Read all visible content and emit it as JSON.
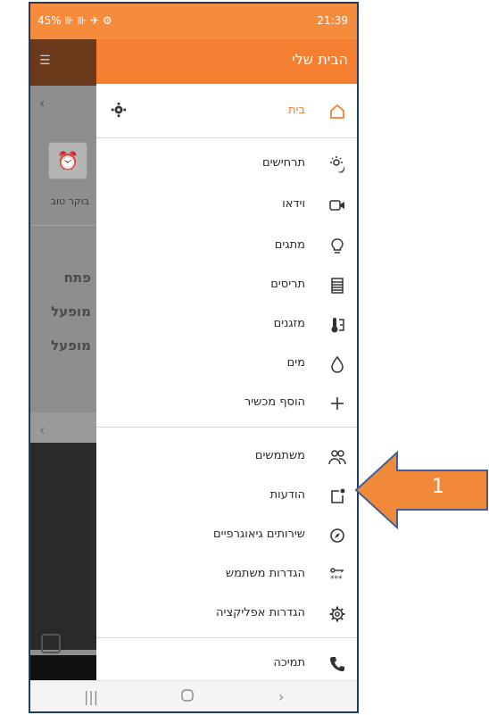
{
  "status_bar": {
    "left_text": "45% ⊪ ⊪ ✈ ⚙",
    "time": "21:39"
  },
  "background_app": {
    "alarm_label": "בוקר טוב",
    "statuses": [
      "פתח",
      "מופעל",
      "מופעל"
    ]
  },
  "drawer": {
    "title": "הבית שלי",
    "home_label": "בית",
    "devices": [
      {
        "label": "תרחישים",
        "icon": "scenes-icon"
      },
      {
        "label": "וידאו",
        "icon": "video-camera-icon"
      },
      {
        "label": "מתגים",
        "icon": "lightbulb-icon"
      },
      {
        "label": "תריסים",
        "icon": "shutters-icon"
      },
      {
        "label": "מזגנים",
        "icon": "thermometer-icon"
      },
      {
        "label": "מים",
        "icon": "water-drop-icon"
      },
      {
        "label": "הוסף מכשיר",
        "icon": "plus-icon"
      }
    ],
    "account": [
      {
        "label": "משתמשים",
        "icon": "users-icon"
      },
      {
        "label": "הודעות",
        "icon": "notifications-icon"
      },
      {
        "label": "שירותים גיאוגרפיים",
        "icon": "compass-icon"
      },
      {
        "label": "הגדרות משתמש",
        "icon": "user-key-icon"
      },
      {
        "label": "הגדרות אפליקציה",
        "icon": "gear-icon"
      }
    ],
    "support_label": "תמיכה"
  },
  "callout": {
    "number": "1",
    "color": "#f08a3a"
  },
  "colors": {
    "accent": "#f47f30",
    "frame": "#1f3b63"
  }
}
